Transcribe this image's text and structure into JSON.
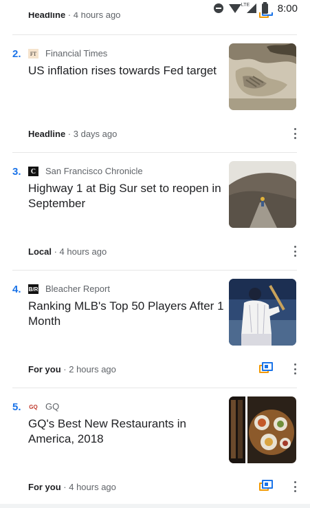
{
  "status_bar": {
    "time": "8:00",
    "network": "LTE"
  },
  "partial_story": {
    "category": "Headline",
    "time": "4 hours ago"
  },
  "stories": [
    {
      "rank": "2.",
      "source": "Financial Times",
      "source_logo": "FT",
      "headline": "US inflation rises towards Fed target",
      "category": "Headline",
      "time": "3 days ago",
      "thumbnail": "eagle-sculpture-photo",
      "full_coverage": false
    },
    {
      "rank": "3.",
      "source": "San Francisco Chronicle",
      "source_logo": "C",
      "headline": "Highway 1 at Big Sur set to reopen in September",
      "category": "Local",
      "time": "4 hours ago",
      "thumbnail": "highway-hillside-photo",
      "full_coverage": false
    },
    {
      "rank": "4.",
      "source": "Bleacher Report",
      "source_logo": "B/R",
      "headline": "Ranking MLB's Top 50 Players After 1 Month",
      "category": "For you",
      "time": "2 hours ago",
      "thumbnail": "baseball-player-photo",
      "full_coverage": true
    },
    {
      "rank": "5.",
      "source": "GQ",
      "source_logo": "GQ",
      "headline": "GQ's Best New Restaurants in America, 2018",
      "category": "For you",
      "time": "4 hours ago",
      "thumbnail": "restaurant-food-photo",
      "full_coverage": true
    }
  ],
  "colors": {
    "rank_blue": "#1a73e8",
    "meta_grey": "#5f6368",
    "coverage_orange": "#f29900"
  }
}
